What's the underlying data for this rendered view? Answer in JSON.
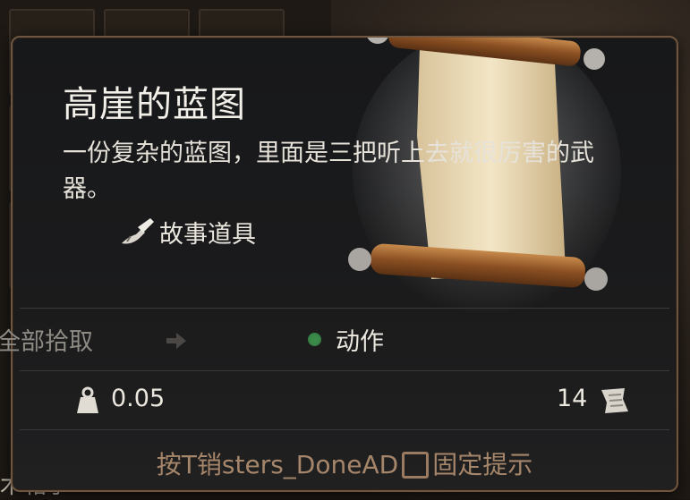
{
  "tooltip": {
    "title": "高崖的蓝图",
    "description": "一份复杂的蓝图，里面是三把听上去就很厉害的武器。",
    "tag_label": "故事道具",
    "tag_icon": "scroll-quill-icon",
    "item_icon": "rolled-scroll-icon"
  },
  "actions": {
    "loot_all_label": "全部拾取",
    "arrow_icon": "arrow-right-icon",
    "action_label": "动作",
    "action_dot_color": "#3c8a4a"
  },
  "stats": {
    "weight": "0.05",
    "weight_icon": "weight-icon",
    "price": "14",
    "price_icon": "coin-stack-icon"
  },
  "hint": {
    "prefix": "按",
    "key_text": "T销sters_DoneAD",
    "suffix": "固定提示"
  },
  "background": {
    "bottom_text": "木箱子"
  }
}
